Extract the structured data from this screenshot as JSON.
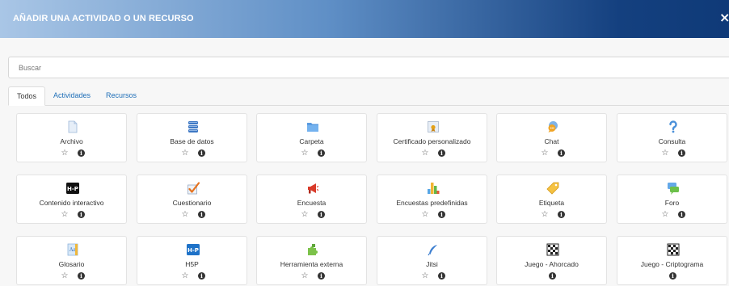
{
  "modal": {
    "title": "AÑADIR UNA ACTIVIDAD O UN RECURSO",
    "close_symbol": "×"
  },
  "search": {
    "placeholder": "Buscar"
  },
  "tabs": [
    {
      "label": "Todos",
      "active": true
    },
    {
      "label": "Actividades",
      "active": false
    },
    {
      "label": "Recursos",
      "active": false
    }
  ],
  "star_symbol": "☆",
  "info_symbol": "i",
  "items": [
    {
      "name": "Archivo",
      "icon": "file-icon",
      "starrable": true
    },
    {
      "name": "Base de datos",
      "icon": "database-icon",
      "starrable": true
    },
    {
      "name": "Carpeta",
      "icon": "folder-icon",
      "starrable": true
    },
    {
      "name": "Certificado personalizado",
      "icon": "certificate-icon",
      "starrable": true
    },
    {
      "name": "Chat",
      "icon": "chat-icon",
      "starrable": true
    },
    {
      "name": "Consulta",
      "icon": "question-icon",
      "starrable": true
    },
    {
      "name": "Contenido interactivo",
      "icon": "h5p-black-icon",
      "starrable": true
    },
    {
      "name": "Cuestionario",
      "icon": "quiz-icon",
      "starrable": true
    },
    {
      "name": "Encuesta",
      "icon": "megaphone-icon",
      "starrable": true
    },
    {
      "name": "Encuestas predefinidas",
      "icon": "survey-chart-icon",
      "starrable": true
    },
    {
      "name": "Etiqueta",
      "icon": "tag-icon",
      "starrable": true
    },
    {
      "name": "Foro",
      "icon": "forum-icon",
      "starrable": true
    },
    {
      "name": "Glosario",
      "icon": "glossary-icon",
      "starrable": true
    },
    {
      "name": "H5P",
      "icon": "h5p-blue-icon",
      "starrable": true
    },
    {
      "name": "Herramienta externa",
      "icon": "puzzle-icon",
      "starrable": true
    },
    {
      "name": "Jitsi",
      "icon": "feather-icon",
      "starrable": true
    },
    {
      "name": "Juego - Ahorcado",
      "icon": "game-grid-icon",
      "starrable": false
    },
    {
      "name": "Juego - Criptograma",
      "icon": "game-grid-icon",
      "starrable": false
    }
  ],
  "colors": {
    "header_start": "#a9c6e6",
    "header_end": "#0f3a78",
    "link": "#1f6fb8"
  }
}
